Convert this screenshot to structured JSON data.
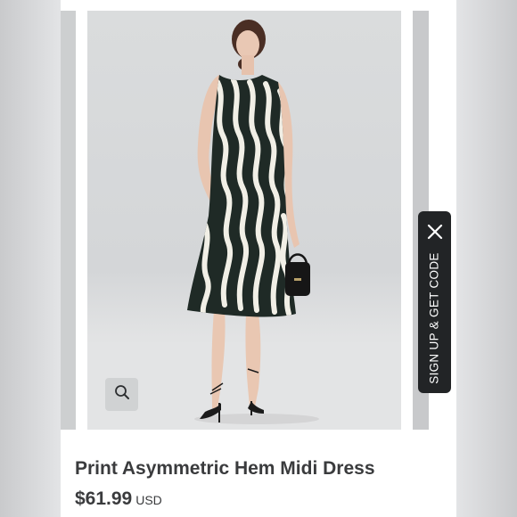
{
  "product": {
    "title": "Print Asymmetric Hem Midi Dress",
    "price": "$61.99",
    "currency": "USD"
  },
  "gallery": {
    "zoom_icon": "magnifier-icon"
  },
  "signup_tab": {
    "label": "SIGN UP & GET CODE",
    "close_icon": "close-icon"
  },
  "colors": {
    "signup_background": "#222426",
    "dress_print_dark": "#1f2a26",
    "dress_print_light": "#f1efe6"
  }
}
